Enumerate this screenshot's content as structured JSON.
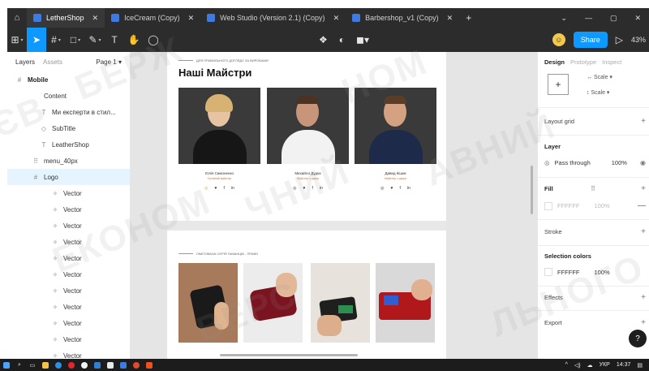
{
  "tabs": [
    {
      "label": "LetherShop",
      "active": true
    },
    {
      "label": "IceCream (Copy)",
      "active": false
    },
    {
      "label": "Web Studio (Version 2.1) (Copy)",
      "active": false
    },
    {
      "label": "Barbershop_v1 (Copy)",
      "active": false
    }
  ],
  "toolbar": {
    "share_label": "Share",
    "zoom": "43%"
  },
  "layers_panel": {
    "tab_layers": "Layers",
    "tab_assets": "Assets",
    "page": "Page 1",
    "items": [
      {
        "label": "Mobile",
        "icon": "frame-icon",
        "bold": true
      },
      {
        "label": "Content",
        "icon": "none",
        "bold": false
      },
      {
        "label": "Ми експерти в стил...",
        "icon": "text-icon",
        "bold": false
      },
      {
        "label": "SubTitle",
        "icon": "component-icon",
        "bold": false
      },
      {
        "label": "LeatherShop",
        "icon": "text-icon",
        "bold": false
      },
      {
        "label": "menu_40px",
        "icon": "grid-icon",
        "bold": false
      },
      {
        "label": "Logo",
        "icon": "frame-icon",
        "bold": false,
        "selected": true
      },
      {
        "label": "Vector",
        "icon": "vector-icon"
      },
      {
        "label": "Vector",
        "icon": "vector-icon"
      },
      {
        "label": "Vector",
        "icon": "vector-icon"
      },
      {
        "label": "Vector",
        "icon": "vector-icon"
      },
      {
        "label": "Vector",
        "icon": "vector-icon"
      },
      {
        "label": "Vector",
        "icon": "vector-icon"
      },
      {
        "label": "Vector",
        "icon": "vector-icon"
      },
      {
        "label": "Vector",
        "icon": "vector-icon"
      },
      {
        "label": "Vector",
        "icon": "vector-icon"
      },
      {
        "label": "Vector",
        "icon": "vector-icon"
      },
      {
        "label": "Vector",
        "icon": "vector-icon"
      }
    ]
  },
  "canvas": {
    "eyebrow_top": "ДЛЯ ПРАВИЛЬНОГО ДОГЛЯДУ ЗА ВИРОБАМИ",
    "title": "Наші Майстри",
    "masters": [
      {
        "name": "Юлія Симоненко",
        "role": "Головний майстер"
      },
      {
        "name": "Михайло Дудка",
        "role": "Майстер з шкіри"
      },
      {
        "name": "Давид Кішик",
        "role": "Майстер з шкіри"
      }
    ],
    "socials": [
      "◎",
      "♥",
      "f",
      "in"
    ],
    "eyebrow_bottom": "ЛІМІТОВАНА СЕРІЯ ГАМАНЦІВ - ПРАВО"
  },
  "design_panel": {
    "tab_design": "Design",
    "tab_prototype": "Prototype",
    "tab_inspect": "Inspect",
    "scale_h": "Scale",
    "scale_v": "Scale",
    "layout_grid": "Layout grid",
    "layer_title": "Layer",
    "blend_mode": "Pass through",
    "opacity": "100%",
    "fill_title": "Fill",
    "fill_hex": "FFFFFF",
    "fill_opacity": "100%",
    "stroke": "Stroke",
    "selection_colors": "Selection colors",
    "sel_hex": "FFFFFF",
    "sel_opacity": "100%",
    "effects": "Effects",
    "export": "Export",
    "help": "?"
  },
  "taskbar": {
    "lang": "УКР",
    "time": "14:37"
  },
  "colors": {
    "accent": "#0d99ff",
    "dark_ui": "#2c2c2c",
    "selection": "#e5f4ff"
  }
}
